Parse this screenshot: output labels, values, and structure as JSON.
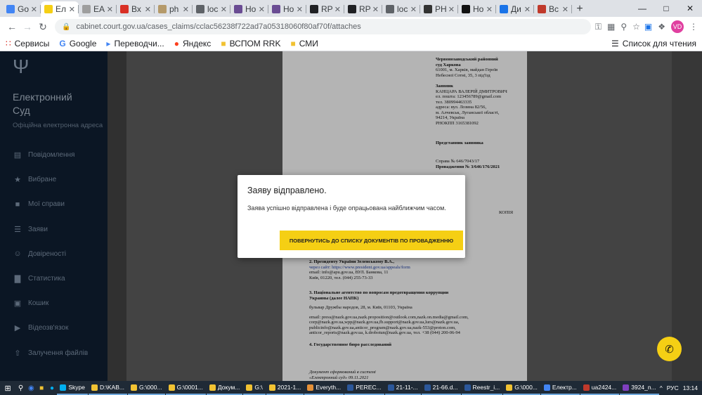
{
  "browser": {
    "tabs": [
      {
        "icon": "google-icon",
        "title": "Go",
        "color": "#4285f4"
      },
      {
        "icon": "ukraine-flag-icon",
        "title": "Ел",
        "color": "#f5cf14",
        "active": true
      },
      {
        "icon": "bird-icon",
        "title": "EA",
        "color": "#9e9e9e"
      },
      {
        "icon": "gmail-icon",
        "title": "Вх",
        "color": "#d93025"
      },
      {
        "icon": "image-icon",
        "title": "ph",
        "color": "#b59a6a"
      },
      {
        "icon": "globe-icon",
        "title": "loc",
        "color": "#5f6368"
      },
      {
        "icon": "doc-icon",
        "title": "Но",
        "color": "#6a4c93"
      },
      {
        "icon": "doc-icon",
        "title": "Но",
        "color": "#6a4c93"
      },
      {
        "icon": "d-icon",
        "title": "RP",
        "color": "#202124"
      },
      {
        "icon": "d-icon",
        "title": "RP",
        "color": "#202124"
      },
      {
        "icon": "globe-icon",
        "title": "loc",
        "color": "#5f6368"
      },
      {
        "icon": "rs-icon",
        "title": "PH",
        "color": "#333333"
      },
      {
        "icon": "a-icon",
        "title": "Но",
        "color": "#111111"
      },
      {
        "icon": "d-icon",
        "title": "Ди",
        "color": "#1a73e8"
      },
      {
        "icon": "w-icon",
        "title": "Вс",
        "color": "#c0392b"
      }
    ],
    "new_tab": "+",
    "url": "cabinet.court.gov.ua/cases_claims/cclac56238f722ad7a05318060f80af70f/attaches",
    "bookmarks": [
      {
        "icon": "apps-icon",
        "label": "Сервисы"
      },
      {
        "icon": "google-icon",
        "label": "Google"
      },
      {
        "icon": "translate-icon",
        "label": "Переводчи..."
      },
      {
        "icon": "yandex-icon",
        "label": "Яндекс"
      },
      {
        "icon": "folder-icon",
        "label": "ВСПОМ RRK"
      },
      {
        "icon": "folder-icon",
        "label": "СМИ"
      }
    ],
    "reading_list": "Список для чтения",
    "profile_initials": "VD"
  },
  "sidebar": {
    "brand_line1": "Електронний",
    "brand_line2": "Суд",
    "subtitle": "Офіційна електронна адреса",
    "items": [
      {
        "icon": "message-icon",
        "label": "Повідомлення"
      },
      {
        "icon": "star-icon",
        "label": "Вибране"
      },
      {
        "icon": "folder-icon",
        "label": "Мої справи"
      },
      {
        "icon": "list-icon",
        "label": "Заяви"
      },
      {
        "icon": "users-icon",
        "label": "Довіреності"
      },
      {
        "icon": "chart-icon",
        "label": "Статистика"
      },
      {
        "icon": "wallet-icon",
        "label": "Кошик"
      },
      {
        "icon": "video-icon",
        "label": "Відеозв'язок"
      },
      {
        "icon": "upload-icon",
        "label": "Залучення файлів"
      }
    ]
  },
  "document": {
    "court_name": "Червонозаводський районний",
    "court_name2": "суд Харкова",
    "court_addr1": "61001, м. Харків, майдан Героїв",
    "court_addr2": "Небесної Сотні, 35, 3 під'їзд",
    "applicant_label": "Заявник",
    "applicant_name": "КАНЦАРА ВАЛЕРІЙ ДМИТРОВИЧ",
    "applicant_email": "ел. пошта: 123456789@gmail.com",
    "applicant_tel": "тел. 380994463335",
    "applicant_addr1": "адреса: вул. Лозина 82/56,",
    "applicant_addr2": "м. Алчевськ, Луганської області,",
    "applicant_addr3": "94214, Україна",
    "applicant_rnokpp": "РНОКПП 3165381092",
    "rep_label": "Представник заявника",
    "case_no": "Справа № 646/7043/17",
    "proceedings_no": "Провадження № 3/646/176/2021",
    "copy_stamp": "КОПІЯ",
    "item3_title": "2. Президенту України Зеленському В.А.,",
    "item3_site": "через сайт: https://www.president.gov.ua/appeals/form",
    "item3_email": "email: info@apu.gov.ua, ВУЛ. Банкова, 11",
    "item3_addr": "Київ, 01220, тел. (044) 255-73-33",
    "item4_title": "3. Національне агентство по вопросам предотвращения коррупции",
    "item4_title2": "Украины (далее НАПК)",
    "item4_addr": "бульвар Дружбы народов, 28, м. Київ, 01103, Україна",
    "item4_emails1": "email: press@nazk.gov.ua,nazk.proposition@outlook.com,nazk.on.media@gmail.com,",
    "item4_emails2": "corp@nazk.gov.ua,wpp@nazk.gov.ua,fb.support@nazk.gov.ua,lurs@nazk.gov.ua,",
    "item4_emails3": "publicinfo@nazk.gov.ua,anticor_program@nazk.gov.ua,nazk-553@proton.com,",
    "item4_emails4": "anticor_reports@nazk.gov.ua, k.drobotun@nazk.gov.ua, тел. +38 (044) 200-06-94",
    "item5_title": "4. Государственное бюро расследований",
    "footer1": "Документ сформований в системі",
    "footer2": "«Електронний суд» 09.11.2021"
  },
  "modal": {
    "title": "Заяву відправлено.",
    "message": "Заява успішно відправлена і буде опрацьована найближчим часом.",
    "button": "ПОВЕРНУТИСЬ ДО СПИСКУ ДОКУМЕНТІВ ПО ПРОВАДЖЕННЮ"
  },
  "taskbar": {
    "items": [
      {
        "label": "Skype",
        "color": "#00aff0"
      },
      {
        "label": "D:\\KAB...",
        "color": "#f1c232"
      },
      {
        "label": "G:\\000...",
        "color": "#f1c232"
      },
      {
        "label": "G:\\0001...",
        "color": "#f1c232"
      },
      {
        "label": "Докум...",
        "color": "#f1c232"
      },
      {
        "label": "G:\\",
        "color": "#f1c232"
      },
      {
        "label": "2021-1...",
        "color": "#f1c232"
      },
      {
        "label": "Everyth...",
        "color": "#e69138"
      },
      {
        "label": "PEREC...",
        "color": "#2b579a"
      },
      {
        "label": "21-11-...",
        "color": "#2b579a"
      },
      {
        "label": "21-66.d...",
        "color": "#2b579a"
      },
      {
        "label": "Reestr_i...",
        "color": "#2b579a"
      },
      {
        "label": "G:\\000...",
        "color": "#f1c232"
      },
      {
        "label": "Електр...",
        "color": "#4285f4"
      },
      {
        "label": "ua2424...",
        "color": "#c0392b"
      },
      {
        "label": "3924_n...",
        "color": "#7f3fbf"
      }
    ],
    "lang": "РУС",
    "time": "13:14"
  }
}
